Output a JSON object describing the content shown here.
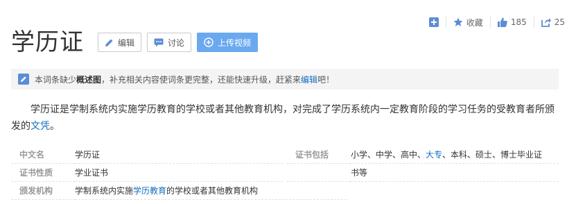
{
  "topbar": {
    "add_label": "",
    "favorite_label": "收藏",
    "like_count": "185",
    "share_count": "25"
  },
  "title": "学历证",
  "buttons": {
    "edit": "编辑",
    "discuss": "讨论",
    "upload_video": "上传视频"
  },
  "notice": {
    "prefix": "本词条缺少",
    "bold": "概述图",
    "middle": "，补充相关内容使词条更完整，还能快速升级，赶紧来",
    "link": "编辑",
    "suffix": "吧！"
  },
  "summary": {
    "text": "学历证是学制系统内实施学历教育的学校或者其他教育机构，对完成了学历系统内一定教育阶段的学习任务的受教育者所颁发的",
    "link": "文凭",
    "end": "。"
  },
  "info": {
    "row1": {
      "key": "中文名",
      "val": "学历证",
      "key2": "证书包括",
      "val2_a": "小学、中学、高中、",
      "val2_link": "大专",
      "val2_b": "、本科、硕士、博士毕业证"
    },
    "row2": {
      "key": "证书性质",
      "val": "学业证书",
      "val2": "书等"
    },
    "row3": {
      "key": "颁发机构",
      "val_a": "学制系统内实施",
      "val_link": "学历教育",
      "val_b": "的学校或者其他教育机构"
    }
  },
  "colors": {
    "link": "#136ec2",
    "primary_button": "#6aa9f0",
    "icon_blue": "#5c8dd3"
  }
}
